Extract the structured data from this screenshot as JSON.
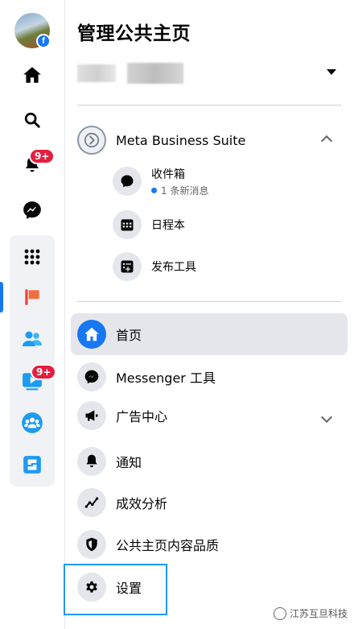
{
  "rail": {
    "notifications_badge": "9+",
    "video_badge": "9+"
  },
  "panel": {
    "title": "管理公共主页",
    "meta_suite": {
      "label": "Meta Business Suite",
      "items": [
        {
          "label": "收件箱",
          "meta": "1 条新消息",
          "icon": "messenger-bubble-icon"
        },
        {
          "label": "日程本",
          "icon": "calendar-icon"
        },
        {
          "label": "发布工具",
          "icon": "publishing-tools-icon"
        }
      ]
    },
    "nav": [
      {
        "label": "首页",
        "icon": "home-icon",
        "active": true
      },
      {
        "label": "Messenger 工具",
        "icon": "messenger-icon"
      },
      {
        "label": "广告中心",
        "icon": "megaphone-icon",
        "expandable": true
      },
      {
        "label": "通知",
        "icon": "bell-icon"
      },
      {
        "label": "成效分析",
        "icon": "insights-icon"
      },
      {
        "label": "公共主页内容品质",
        "icon": "shield-icon"
      },
      {
        "label": "设置",
        "icon": "gear-icon",
        "highlighted": true
      }
    ]
  },
  "watermark": "江苏互旦科技",
  "colors": {
    "accent": "#1877f2",
    "badge": "#e41e3f",
    "highlight_box": "#2196f3"
  }
}
